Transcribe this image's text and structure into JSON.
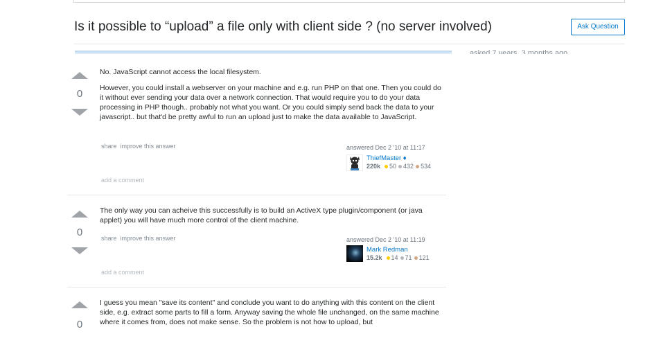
{
  "question": {
    "title": "Is it possible to “upload” a file only with client side ? (no server involved)",
    "ask_button": "Ask Question"
  },
  "sidebar": {
    "asked_text": "asked   7 years, 3 months ago"
  },
  "answers": [
    {
      "votes": "0",
      "paragraphs": [
        "No. JavaScript cannot access the local filesystem.",
        "However, you could install a webserver on your machine and e.g. run PHP on that one. Then you could do it without ever sending your data over a network connection. That would require you to do your data processing in PHP though.. probably not what you want. Or you could simply send back the data to your javascript.. but that'd be pretty awful to run an upload just to make the data available to JavaScript."
      ],
      "menu": {
        "share": "share",
        "improve": "improve this answer"
      },
      "answered": "answered Dec 2 '10 at 11:17",
      "user": {
        "name": "ThiefMaster",
        "diamond": "♦",
        "rep": "220k",
        "gold": "50",
        "silver": "432",
        "bronze": "534"
      },
      "add_comment": "add a comment"
    },
    {
      "votes": "0",
      "paragraphs": [
        "The only way you can acheive this successfully is to build an ActiveX type plugin/component (or java applet) you will have much more control of the client machine."
      ],
      "menu": {
        "share": "share",
        "improve": "improve this answer"
      },
      "answered": "answered Dec 2 '10 at 11:19",
      "user": {
        "name": "Mark Redman",
        "rep": "15.2k",
        "gold": "14",
        "silver": "71",
        "bronze": "121"
      },
      "add_comment": "add a comment"
    },
    {
      "votes": "0",
      "paragraphs": [
        "I guess you mean \"save its content\" and conclude you want to do anything with this content on the client side, e.g. extract some parts to fill a form. Anyway saving the whole file unchanged, on the same machine where it comes from, does not make sense. So the problem is not how to upload, but"
      ]
    }
  ]
}
